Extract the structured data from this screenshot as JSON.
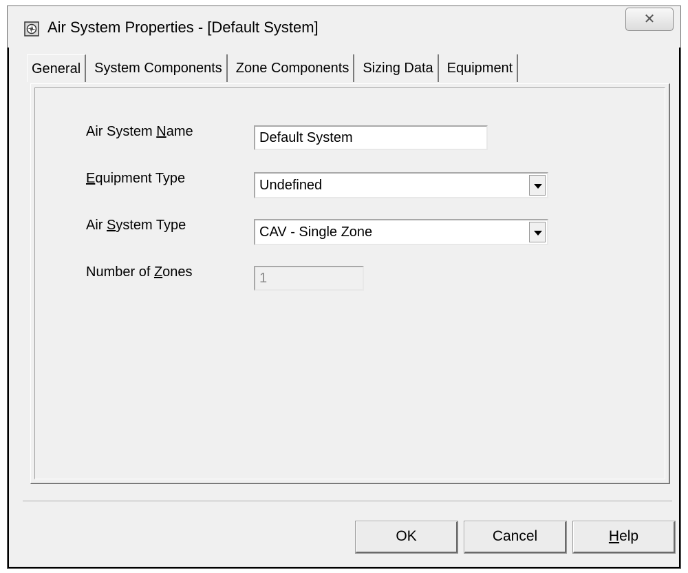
{
  "window": {
    "title": "Air System Properties - [Default System]",
    "close_label": "☒",
    "icon": "fan-icon"
  },
  "tabs": [
    {
      "label": "General"
    },
    {
      "label": "System Components"
    },
    {
      "label": "Zone Components"
    },
    {
      "label": "Sizing Data"
    },
    {
      "label": "Equipment"
    }
  ],
  "form": {
    "air_system_name": {
      "label_pre": "Air System ",
      "label_mnemonic": "N",
      "label_post": "ame",
      "value": "Default System"
    },
    "equipment_type": {
      "label_pre": "",
      "label_mnemonic": "E",
      "label_post": "quipment Type",
      "value": "Undefined"
    },
    "air_system_type": {
      "label_pre": "Air ",
      "label_mnemonic": "S",
      "label_post": "ystem Type",
      "value": "CAV - Single Zone"
    },
    "number_of_zones": {
      "label_pre": "Number of ",
      "label_mnemonic": "Z",
      "label_post": "ones",
      "value": "1"
    }
  },
  "buttons": {
    "ok": "OK",
    "cancel": "Cancel",
    "help_mnemonic": "H",
    "help_rest": "elp"
  }
}
